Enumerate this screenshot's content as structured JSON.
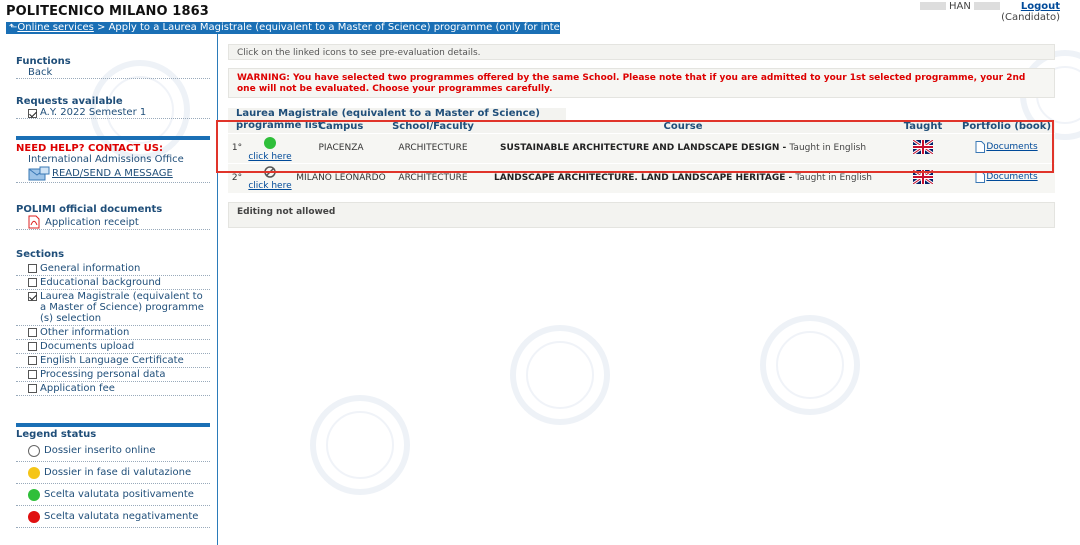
{
  "header": {
    "brand": "POLITECNICO MILANO 1863",
    "user_name": "HAN",
    "logout_label": "Logout",
    "role": "(Candidato)"
  },
  "breadcrumb": {
    "arrow": "⬑",
    "link_label": "Online services",
    "separator": " > ",
    "current": "Apply to a Laurea Magistrale (equivalent to a Master of Science) programme (only for international a"
  },
  "sidebar": {
    "functions": {
      "title": "Functions",
      "back": "Back"
    },
    "requests": {
      "title": "Requests available",
      "item": "A.Y. 2022 Semester 1"
    },
    "help": {
      "title": "NEED HELP? CONTACT US:",
      "office": "International Admissions Office",
      "message": "READ/SEND A MESSAGE"
    },
    "documents": {
      "title": "POLIMI official documents",
      "receipt": "Application receipt"
    },
    "sections": {
      "title": "Sections",
      "items": [
        {
          "label": "General information",
          "checked": false
        },
        {
          "label": "Educational background",
          "checked": false
        },
        {
          "label": "Laurea Magistrale (equivalent to a Master of Science) programme (s) selection",
          "checked": true
        },
        {
          "label": "Other information",
          "checked": false
        },
        {
          "label": "Documents upload",
          "checked": false
        },
        {
          "label": "English Language Certificate",
          "checked": false
        },
        {
          "label": "Processing personal data",
          "checked": false
        },
        {
          "label": "Application fee",
          "checked": false
        }
      ]
    },
    "legend": {
      "title": "Legend status",
      "items": [
        {
          "label": "Dossier inserito online",
          "color": "#ffffff"
        },
        {
          "label": "Dossier in fase di valutazione",
          "color": "#f5c518"
        },
        {
          "label": "Scelta valutata positivamente",
          "color": "#2fbf3a"
        },
        {
          "label": "Scelta valutata negativamente",
          "color": "#e01010"
        }
      ]
    }
  },
  "main": {
    "info": "Click on the linked icons to see pre-evaluation details.",
    "warning": "WARNING: You have selected two programmes offered by the same School. Please note that if you are admitted to your 1st selected programme, your 2nd one will not be evaluated. Choose your programmes carefully.",
    "table_title": "Laurea Magistrale (equivalent to a Master of Science) programme list",
    "columns": [
      "Campus",
      "School/Faculty",
      "Course",
      "Taught",
      "Portfolio (book)"
    ],
    "rows": [
      {
        "order": "1°",
        "status": "positive",
        "status_link": "click here",
        "campus": "PIACENZA",
        "school": "ARCHITECTURE",
        "course": "SUSTAINABLE ARCHITECTURE AND LANDSCAPE DESIGN",
        "taught_text": "Taught in English",
        "portfolio": "Documents"
      },
      {
        "order": "2°",
        "status": "none",
        "status_link": "click here",
        "campus": "MILANO LEONARDO",
        "school": "ARCHITECTURE",
        "course": "LANDSCAPE ARCHITECTURE. LAND LANDSCAPE HERITAGE",
        "taught_text": "Taught in English",
        "portfolio": "Documents"
      }
    ],
    "editing": "Editing not allowed"
  },
  "colors": {
    "accent": "#1a6fb5",
    "warning": "#dd0000",
    "highlight": "#e0342a"
  }
}
